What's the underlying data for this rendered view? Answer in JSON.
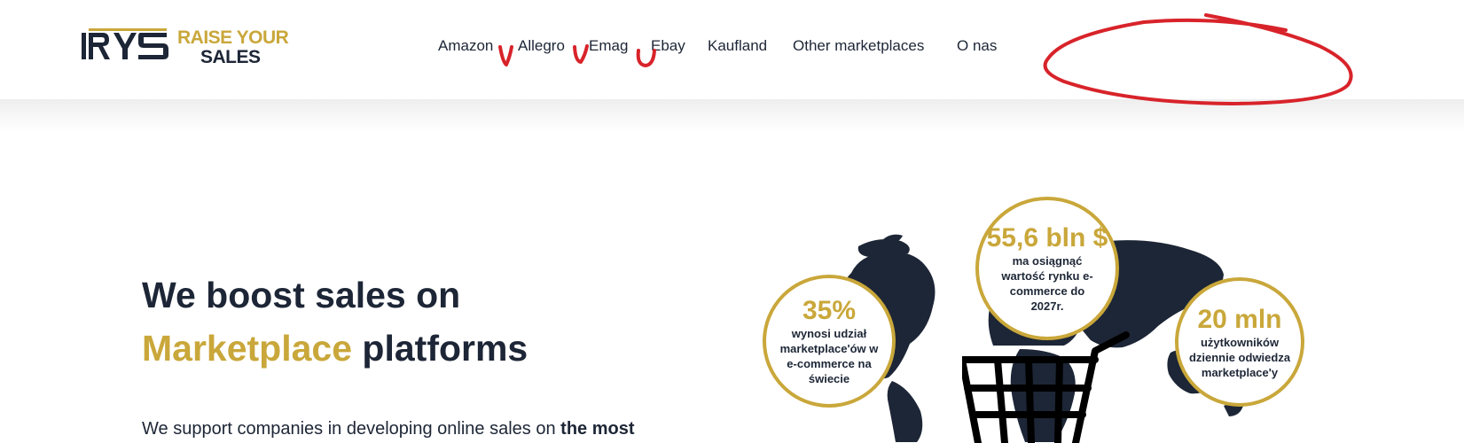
{
  "header": {
    "logo": {
      "mark": "RYS",
      "line1": "RAISE YOUR",
      "line2": "SALES"
    },
    "nav": [
      "Amazon",
      "Allegro",
      "Emag",
      "Ebay",
      "Kaufland",
      "Other marketplaces",
      "O nas"
    ]
  },
  "hero": {
    "title_part1": "We boost sales on",
    "title_highlight": "Marketplace",
    "title_part2": "platforms",
    "text_plain": "We support companies in developing online sales on ",
    "text_bold": "the most"
  },
  "stats": [
    {
      "value": "35%",
      "desc": "wynosi udział marketplace'ów w e-commerce na świecie"
    },
    {
      "value": "55,6 bln $",
      "desc": "ma osiągnąć wartość rynku e-commerce do 2027r."
    },
    {
      "value": "20 mln",
      "desc": "użytkowników dziennie odwiedza marketplace'y"
    }
  ],
  "colors": {
    "gold": "#c9a73a",
    "navy": "#1d2636",
    "annotation": "#d8232a",
    "background": "#ffffff"
  },
  "icons": [
    "rys-logo-icon",
    "world-map-icon",
    "shopping-cart-icon"
  ]
}
